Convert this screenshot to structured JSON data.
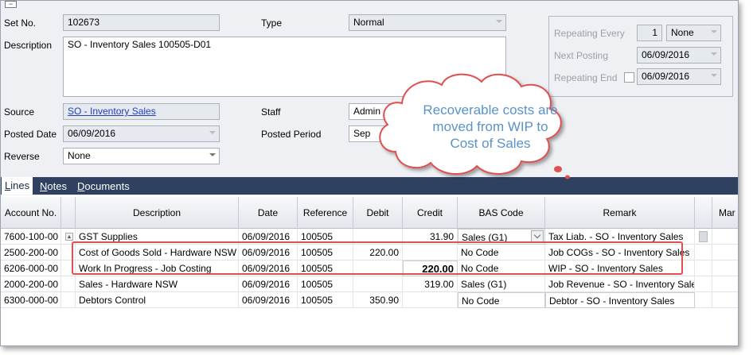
{
  "header": {
    "set_no": {
      "label": "Set No.",
      "value": "102673"
    },
    "type": {
      "label": "Type",
      "value": "Normal"
    },
    "description": {
      "label": "Description",
      "value": "SO - Inventory Sales 100505-D01"
    },
    "source": {
      "label": "Source",
      "value": "SO - Inventory Sales"
    },
    "staff": {
      "label": "Staff",
      "value": "Admin"
    },
    "posted_date": {
      "label": "Posted Date",
      "value": "06/09/2016"
    },
    "posted_period": {
      "label": "Posted Period",
      "value": "Sep"
    },
    "reverse": {
      "label": "Reverse",
      "value": "None"
    }
  },
  "repeat": {
    "every_label": "Repeating Every",
    "every_value": "1",
    "every_unit": "None",
    "next_label": "Next Posting",
    "next_value": "06/09/2016",
    "end_label": "Repeating End",
    "end_value": "06/09/2016"
  },
  "tabs": [
    {
      "first": "L",
      "rest": "ines"
    },
    {
      "first": "N",
      "rest": "otes"
    },
    {
      "first": "D",
      "rest": "ocuments"
    }
  ],
  "grid": {
    "columns": [
      "Account No.",
      "Description",
      "Date",
      "Reference",
      "Debit",
      "Credit",
      "BAS Code",
      "Remark",
      "Mar"
    ],
    "rows": [
      {
        "account": "7600-100-00",
        "description": "GST Supplies",
        "date": "06/09/2016",
        "reference": "100505",
        "debit": "",
        "credit": "31.90",
        "bas": "Sales (G1)",
        "remark": "Tax Liab. - SO - Inventory Sales"
      },
      {
        "account": "2500-200-00",
        "description": "Cost of Goods Sold - Hardware NSW",
        "date": "06/09/2016",
        "reference": "100505",
        "debit": "220.00",
        "credit": "",
        "bas": "No Code",
        "remark": "Job COGs - SO - Inventory Sales"
      },
      {
        "account": "6206-000-00",
        "description": "Work In Progress - Job Costing",
        "date": "06/09/2016",
        "reference": "100505",
        "debit": "",
        "credit": "220.00",
        "bas": "No Code",
        "remark": "WIP - SO - Inventory Sales"
      },
      {
        "account": "2000-200-00",
        "description": "Sales - Hardware NSW",
        "date": "06/09/2016",
        "reference": "100505",
        "debit": "",
        "credit": "319.00",
        "bas": "Sales (G1)",
        "remark": "Job Revenue - SO - Inventory Sales"
      },
      {
        "account": "6300-000-00",
        "description": "Debtors Control",
        "date": "06/09/2016",
        "reference": "100505",
        "debit": "350.90",
        "credit": "",
        "bas": "No Code",
        "remark": "Debtor - SO - Inventory Sales"
      }
    ]
  },
  "callout": {
    "line1": "Recoverable costs are",
    "line2": "moved from WIP to",
    "line3": "Cost of Sales"
  },
  "colors": {
    "tabbar": "#2f4161",
    "highlight": "#e05050",
    "callout_text": "#5a93c8"
  }
}
